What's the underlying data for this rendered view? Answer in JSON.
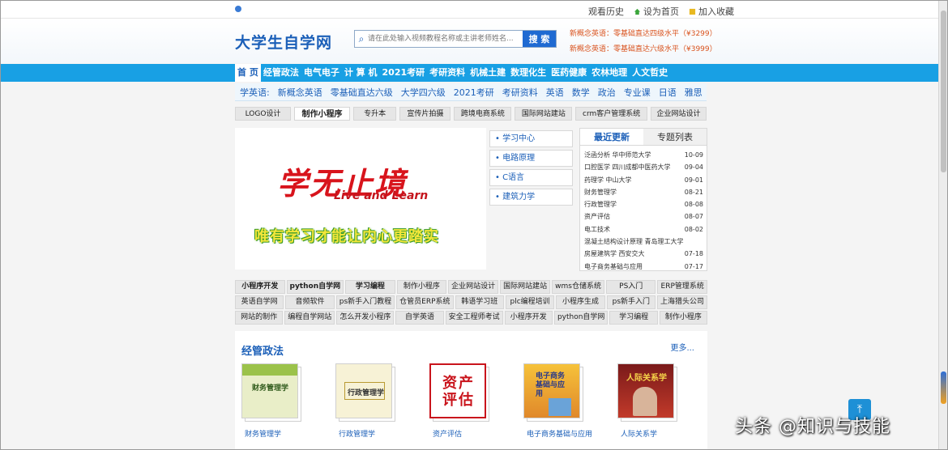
{
  "topbar": {
    "history": "观看历史",
    "set_home": "设为首页",
    "bookmark": "加入收藏"
  },
  "header": {
    "logo": "大学生自学网",
    "search_placeholder": "请在此处输入视频教程名称或主讲老师姓名...",
    "search_button": "搜 索",
    "promo1": "新概念英语：零基础直达四级水平（¥3299）",
    "promo2": "新概念英语：零基础直达六级水平（¥3999）"
  },
  "nav": [
    "首 页",
    "经管政法",
    "电气电子",
    "计 算 机",
    "2021考研",
    "考研资料",
    "机械土建",
    "数理化生",
    "医药健康",
    "农林地理",
    "人文哲史"
  ],
  "subnav": [
    "学英语:",
    "新概念英语",
    "零基础直达六级",
    "大学四六级",
    "2021考研",
    "考研资料",
    "英语",
    "数学",
    "政治",
    "专业课",
    "日语",
    "雅思"
  ],
  "tags": [
    "LOGO设计",
    "制作小程序",
    "专升本",
    "宣传片拍摄",
    "跨境电商系统",
    "国际网站建站",
    "crm客户管理系统",
    "企业网站设计"
  ],
  "banner": {
    "big": "学无止境",
    "sub": "Live and Learn",
    "motto": "唯有学习才能让内心更踏实"
  },
  "quick": [
    "• 学习中心",
    "• 电路原理",
    "• C语言",
    "• 建筑力学"
  ],
  "news": {
    "tabs": [
      "最近更新",
      "专题列表"
    ],
    "items": [
      {
        "title": "泛函分析 华中师范大学",
        "date": "10-09"
      },
      {
        "title": "口腔医学 四川成都中医药大学",
        "date": "09-04"
      },
      {
        "title": "药理学 中山大学",
        "date": "09-01"
      },
      {
        "title": "财务管理学",
        "date": "08-21"
      },
      {
        "title": "行政管理学",
        "date": "08-08"
      },
      {
        "title": "资产评估",
        "date": "08-07"
      },
      {
        "title": "电工技术",
        "date": "08-02"
      },
      {
        "title": "混凝土结构设计原理 青岛理工大学",
        "date": ""
      },
      {
        "title": "房屋建筑学 西安交大",
        "date": "07-18"
      },
      {
        "title": "电子商务基础与应用",
        "date": "07-17"
      }
    ]
  },
  "tag_rows": [
    [
      "小程序开发",
      "python自学网",
      "学习编程",
      "制作小程序",
      "企业网站设计",
      "国际网站建站",
      "wms仓储系统",
      "PS入门",
      "ERP管理系统"
    ],
    [
      "英语自学网",
      "音频软件",
      "ps新手入门教程",
      "仓管员ERP系统",
      "韩语学习班",
      "plc编程培训",
      "小程序生成",
      "ps新手入门",
      "上海猎头公司"
    ],
    [
      "网站的制作",
      "编程自学网站",
      "怎么开发小程序",
      "自学英语",
      "安全工程师考试",
      "小程序开发",
      "python自学网",
      "学习编程",
      "制作小程序"
    ]
  ],
  "section": {
    "title": "经管政法",
    "more": "更多...",
    "books": [
      {
        "caption": "财务管理学",
        "cover": "财务管理学"
      },
      {
        "caption": "行政管理学",
        "cover": "行政管理学"
      },
      {
        "caption": "资产评估",
        "cover": "资产评估"
      },
      {
        "caption": "电子商务基础与应用",
        "cover": "电子商务基础与应用"
      },
      {
        "caption": "人际关系学",
        "cover": "人际关系学"
      }
    ]
  },
  "watermark": "头条 @知识与技能",
  "colors": {
    "brand_blue": "#1b5fb8",
    "nav_blue": "#18a0e4",
    "promo_orange": "#d9531e",
    "banner_red": "#d8141c"
  }
}
